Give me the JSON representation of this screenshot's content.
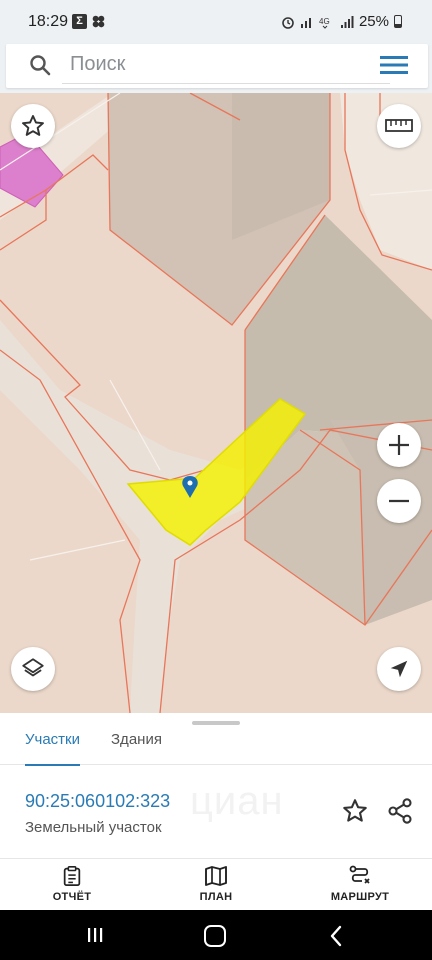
{
  "status_bar": {
    "time": "18:29",
    "battery": "25%"
  },
  "search": {
    "placeholder": "Поиск"
  },
  "map": {
    "selected_parcel_color": "#f4f000",
    "boundary_color": "#e8765a",
    "controls": [
      "favorite",
      "ruler",
      "zoom-in",
      "zoom-out",
      "layers",
      "my-location"
    ]
  },
  "sheet": {
    "tabs": [
      "Участки",
      "Здания"
    ],
    "active_tab": "Участки",
    "parcel_id": "90:25:060102:323",
    "parcel_type": "Земельный участок",
    "watermark": "циан"
  },
  "actions": {
    "report": "ОТЧЁТ",
    "plan": "ПЛАН",
    "route": "МАРШРУТ"
  },
  "colors": {
    "accent": "#2a7bb5"
  }
}
